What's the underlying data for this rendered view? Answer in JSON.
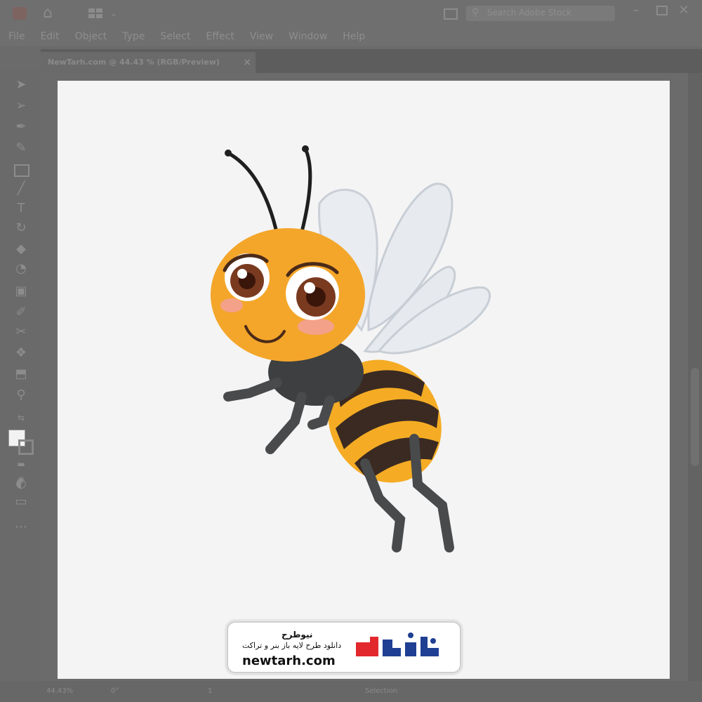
{
  "menu": [
    "File",
    "Edit",
    "Object",
    "Type",
    "Select",
    "Effect",
    "View",
    "Window",
    "Help"
  ],
  "search": {
    "placeholder": "Search Adobe Stock"
  },
  "document_tab": {
    "title": "NewTarh.com @ 44.43 % (RGB/Preview)",
    "close": "×"
  },
  "status": {
    "zoom": "44.43%",
    "rotation": "0°",
    "artboard": "1",
    "tool": "Selection"
  },
  "watermark": {
    "brand_fa": "نیوطرح",
    "tagline_fa": "دانلود طرح لایه باز بنر و تراکت",
    "url": "newtarh.com",
    "logo_fa": "نیوطرح",
    "logo_red": "#e3282d",
    "logo_blue": "#1f3f93"
  },
  "colors": {
    "chrome": "#6f6f6f",
    "artboard": "#f4f4f5"
  }
}
